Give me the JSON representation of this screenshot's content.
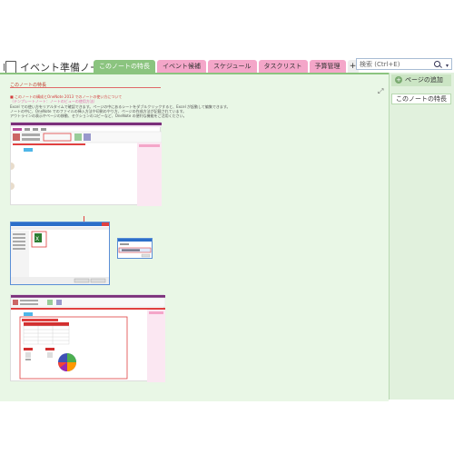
{
  "notebook": {
    "title": "イベント準備ノート"
  },
  "tabs": [
    {
      "label": "このノートの特長",
      "color": "#8bc47f",
      "text_color": "#ffffff"
    },
    {
      "label": "イベント候補",
      "color": "#f4a6c9",
      "text_color": "#333333"
    },
    {
      "label": "スケジュール",
      "color": "#f4a6c9",
      "text_color": "#333333"
    },
    {
      "label": "タスクリスト",
      "color": "#f4a6c9",
      "text_color": "#333333"
    },
    {
      "label": "予算管理",
      "color": "#f4a6c9",
      "text_color": "#333333"
    }
  ],
  "search": {
    "placeholder": "検索 (Ctrl+E)"
  },
  "right_panel": {
    "add_page_label": "ページの追加",
    "pages": [
      "このノートの特長"
    ]
  },
  "page": {
    "date": "このノートの特長",
    "lines": [
      {
        "text": "■ このノートの構成とOneNote 2013 でのノートの使い方について",
        "style": "red"
      },
      {
        "text": "（テンプレートノート：ノートのビューの使用方法）",
        "style": "pink"
      },
      {
        "text": "Excel での使い方をリアルタイムで確認できます。ページの中にあるシートをダブルクリックすると、Excel が起動して編集できます。",
        "style": "gray"
      },
      {
        "text": "ノートの中に、OneNote でのファイルの挿入方法や印刷のやり方、ページの作成方法が記載されています。",
        "style": "gray"
      },
      {
        "text": "アウトラインの表示やページの移動、セクションのコピーなど、OneNote の便利な機能をご活用ください。",
        "style": "gray"
      }
    ]
  },
  "colors": {
    "accent_green": "#8bc47f",
    "accent_pink": "#f4a6c9",
    "page_bg": "#e9f7e6"
  }
}
